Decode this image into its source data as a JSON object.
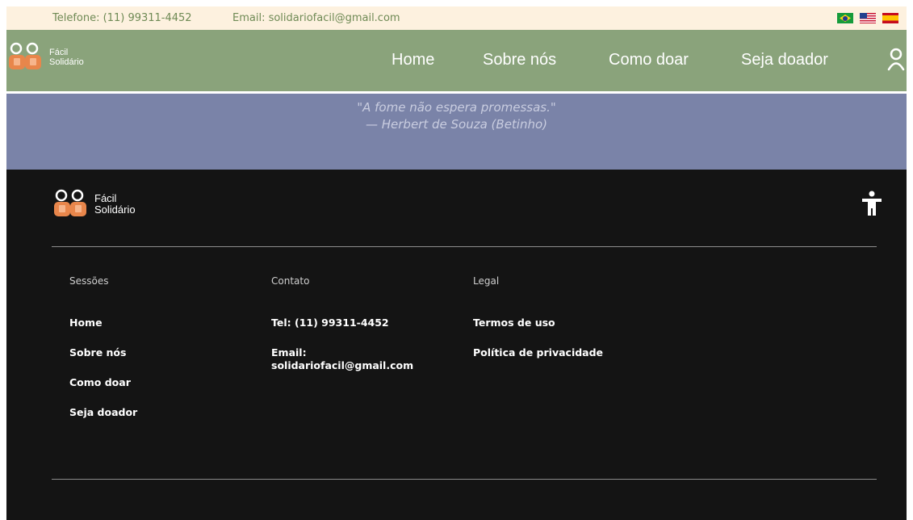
{
  "topbar": {
    "phone": "Telefone: (11) 99311-4452",
    "email": "Email: solidariofacil@gmail.com",
    "flags": [
      "brazil-flag",
      "usa-flag",
      "spain-flag"
    ]
  },
  "brand": {
    "line1": "Fácil",
    "line2": "Solidário"
  },
  "nav": {
    "home": "Home",
    "about": "Sobre nós",
    "donate": "Como doar",
    "donor": "Seja doador"
  },
  "quote": {
    "text": "\"A fome não espera promessas.\"",
    "author": "— Herbert de Souza (Betinho)"
  },
  "footer": {
    "sections": {
      "title": "Sessões",
      "items": [
        "Home",
        "Sobre nós",
        "Como doar",
        "Seja doador"
      ]
    },
    "contact": {
      "title": "Contato",
      "tel": "Tel: (11) 99311-4452",
      "email_label": "Email:",
      "email": "solidariofacil@gmail.com"
    },
    "legal": {
      "title": "Legal",
      "items": [
        "Termos de uso",
        "Política de privacidade"
      ]
    }
  },
  "colors": {
    "topbar": "#fdf1df",
    "nav": "#8aa37b",
    "quote": "#7a83a8",
    "footer": "#141414",
    "logo_orange": "#e8864b"
  },
  "icons": [
    "user-icon",
    "accessibility-icon",
    "logo-icon"
  ]
}
